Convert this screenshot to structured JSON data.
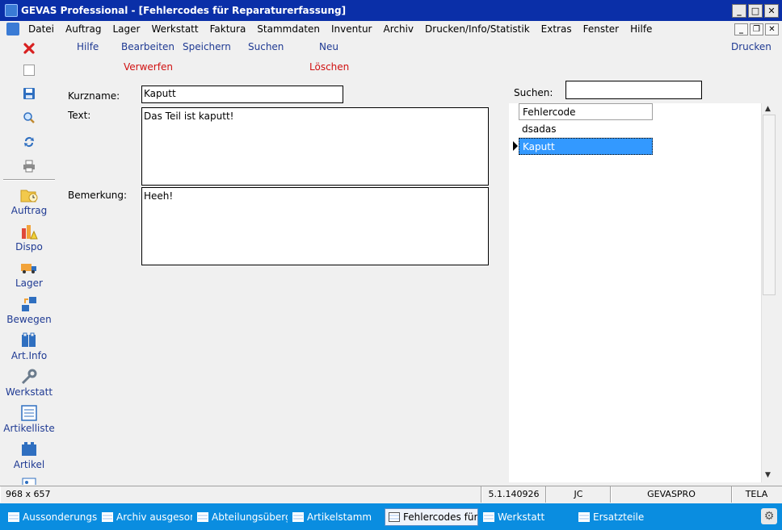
{
  "window": {
    "title": "GEVAS Professional - [Fehlercodes für Reparaturerfassung]",
    "minimize": "_",
    "maximize": "□",
    "close": "✕",
    "mdi_minimize": "_",
    "mdi_restore": "❐",
    "mdi_close": "✕"
  },
  "menu": [
    "Datei",
    "Auftrag",
    "Lager",
    "Werkstatt",
    "Faktura",
    "Stammdaten",
    "Inventur",
    "Archiv",
    "Drucken/Info/Statistik",
    "Extras",
    "Fenster",
    "Hilfe"
  ],
  "toolbar": {
    "hilfe": "Hilfe",
    "bearbeiten": "Bearbeiten",
    "speichern": "Speichern",
    "suchen": "Suchen",
    "neu": "Neu",
    "drucken": "Drucken",
    "verwerfen": "Verwerfen",
    "loeschen": "Löschen"
  },
  "sidebar": {
    "nav": [
      "Auftrag",
      "Dispo",
      "Lager",
      "Bewegen",
      "Art.Info",
      "Werkstatt",
      "Artikelliste",
      "Artikel"
    ]
  },
  "form": {
    "kurzname_label": "Kurzname:",
    "kurzname_value": "Kaputt",
    "text_label": "Text:",
    "text_value": "Das Teil ist kaputt!",
    "bemerkung_label": "Bemerkung:",
    "bemerkung_value": "Heeh!",
    "suchen_label": "Suchen:",
    "suchen_value": ""
  },
  "grid": {
    "header": "Fehlercode",
    "rows": [
      "dsadas",
      "Kaputt"
    ],
    "selected_index": 1
  },
  "status": {
    "size": "968 x 657",
    "version": "5.1.140926",
    "user": "JC",
    "db": "GEVASPRO",
    "site": "TELA"
  },
  "taskbar": {
    "tasks": [
      "Aussonderungsl...",
      "Archiv ausgeson...",
      "Abteilungsüberg...",
      "Artikelstamm",
      "Fehlercodes für ...",
      "Werkstatt",
      "Ersatzteile"
    ],
    "active_index": 4
  },
  "colors": {
    "titlebar": "#0a2fa8",
    "toolbar_text": "#1f3a93",
    "toolbar_danger": "#d01010",
    "selection": "#3399ff",
    "taskbar": "#0a8de0"
  }
}
